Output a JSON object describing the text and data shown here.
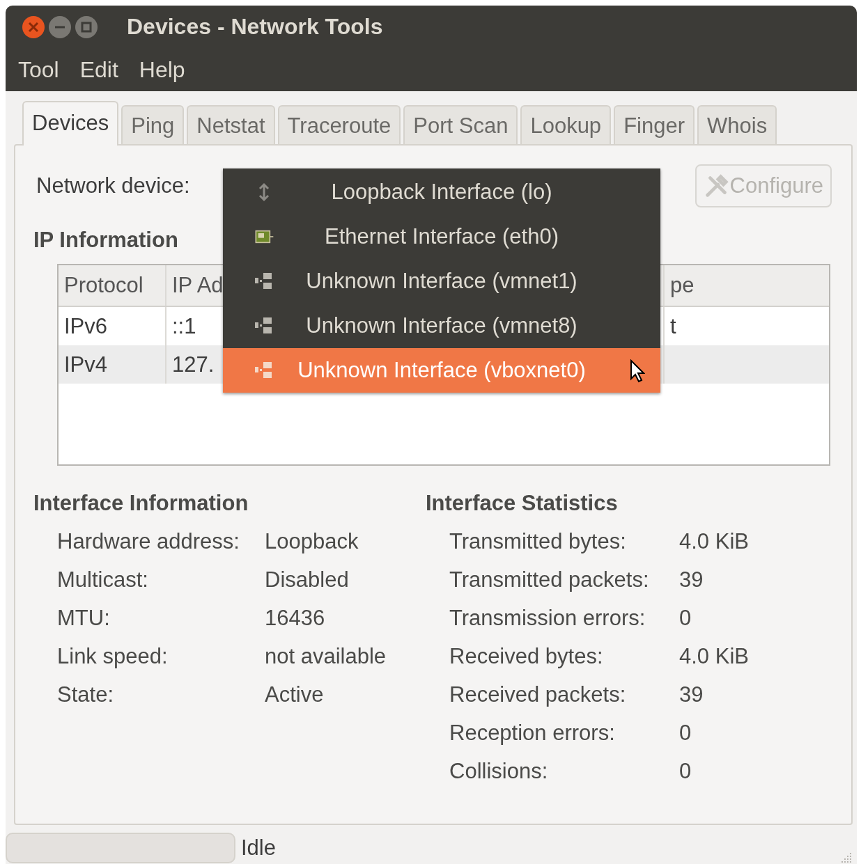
{
  "window": {
    "title": "Devices - Network Tools"
  },
  "menu": [
    "Tool",
    "Edit",
    "Help"
  ],
  "tabs": [
    {
      "label": "Devices",
      "selected": true
    },
    {
      "label": "Ping",
      "selected": false
    },
    {
      "label": "Netstat",
      "selected": false
    },
    {
      "label": "Traceroute",
      "selected": false
    },
    {
      "label": "Port Scan",
      "selected": false
    },
    {
      "label": "Lookup",
      "selected": false
    },
    {
      "label": "Finger",
      "selected": false
    },
    {
      "label": "Whois",
      "selected": false
    }
  ],
  "network_device": {
    "label": "Network device:"
  },
  "configure_button": {
    "label": "Configure",
    "disabled": true
  },
  "device_menu": {
    "items": [
      {
        "label": "Loopback Interface (lo)",
        "kind": "loopback",
        "selected": false
      },
      {
        "label": "Ethernet Interface (eth0)",
        "kind": "ethernet",
        "selected": false
      },
      {
        "label": "Unknown Interface (vmnet1)",
        "kind": "unknown",
        "selected": false
      },
      {
        "label": "Unknown Interface (vmnet8)",
        "kind": "unknown",
        "selected": false
      },
      {
        "label": "Unknown Interface (vboxnet0)",
        "kind": "unknown",
        "selected": true
      }
    ]
  },
  "ip_information": {
    "title": "IP Information",
    "columns": {
      "protocol": "Protocol",
      "ip_address": "IP Ad",
      "column_5": "pe"
    },
    "rows": [
      {
        "protocol": "IPv6",
        "ip_address": "::1",
        "column_5": "t"
      },
      {
        "protocol": "IPv4",
        "ip_address": "127."
      }
    ]
  },
  "interface_information": {
    "title": "Interface Information",
    "fields": [
      {
        "label": "Hardware address:",
        "value": "Loopback"
      },
      {
        "label": "Multicast:",
        "value": "Disabled"
      },
      {
        "label": "MTU:",
        "value": "16436"
      },
      {
        "label": "Link speed:",
        "value": "not available"
      },
      {
        "label": "State:",
        "value": "Active"
      }
    ]
  },
  "interface_statistics": {
    "title": "Interface Statistics",
    "fields": [
      {
        "label": "Transmitted bytes:",
        "value": "4.0 KiB"
      },
      {
        "label": "Transmitted packets:",
        "value": "39"
      },
      {
        "label": "Transmission errors:",
        "value": "0"
      },
      {
        "label": "Received bytes:",
        "value": "4.0 KiB"
      },
      {
        "label": "Received packets:",
        "value": "39"
      },
      {
        "label": "Reception errors:",
        "value": "0"
      },
      {
        "label": "Collisions:",
        "value": "0"
      }
    ]
  },
  "status_bar": {
    "progress": {
      "level": 0
    },
    "text": "Idle"
  }
}
